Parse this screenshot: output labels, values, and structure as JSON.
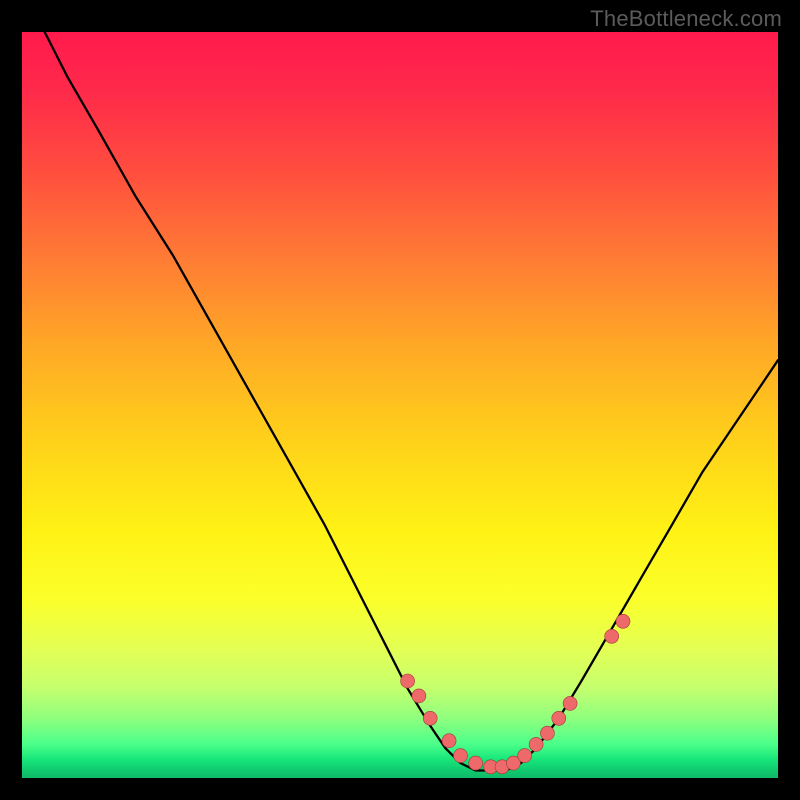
{
  "watermark": "TheBottleneck.com",
  "colors": {
    "page_bg": "#000000",
    "watermark_text": "#5b5b5b",
    "curve": "#000000",
    "marker_fill": "#ee6a6a",
    "marker_stroke": "#a03838",
    "gradient_stops": [
      "#ff1a4d",
      "#ff2a4a",
      "#ff4b3f",
      "#ff7a35",
      "#ffa826",
      "#ffd21a",
      "#fff215",
      "#fbff2a",
      "#e2ff56",
      "#c4ff6e",
      "#8fff7e",
      "#4aff8a",
      "#17e67a",
      "#10c96f",
      "#0fb867"
    ]
  },
  "chart_data": {
    "type": "line",
    "title": "",
    "xlabel": "",
    "ylabel": "",
    "xlim": [
      0,
      100
    ],
    "ylim": [
      0,
      100
    ],
    "grid": false,
    "notes": "V-shaped bottleneck curve. x is a normalized horizontal position (0–100 across the plot area). y is a normalized bottleneck/mismatch percentage (0 = perfect balance at bottom green band, 100 = worst at top red).",
    "series": [
      {
        "name": "bottleneck_curve",
        "x": [
          3,
          6,
          10,
          15,
          20,
          25,
          30,
          35,
          40,
          45,
          48,
          51,
          54,
          56,
          58,
          60,
          62,
          64,
          66,
          68,
          71,
          74,
          78,
          82,
          86,
          90,
          94,
          98,
          100
        ],
        "y": [
          100,
          94,
          87,
          78,
          70,
          61,
          52,
          43,
          34,
          24,
          18,
          12,
          7,
          4,
          2,
          1,
          1,
          1,
          2,
          4,
          8,
          13,
          20,
          27,
          34,
          41,
          47,
          53,
          56
        ]
      }
    ],
    "markers": {
      "name": "highlighted_points",
      "x": [
        51,
        52.5,
        54,
        56.5,
        58,
        60,
        62,
        63.5,
        65,
        66.5,
        68,
        69.5,
        71,
        72.5,
        78,
        79.5
      ],
      "y": [
        13,
        11,
        8,
        5,
        3,
        2,
        1.5,
        1.5,
        2,
        3,
        4.5,
        6,
        8,
        10,
        19,
        21
      ]
    }
  }
}
